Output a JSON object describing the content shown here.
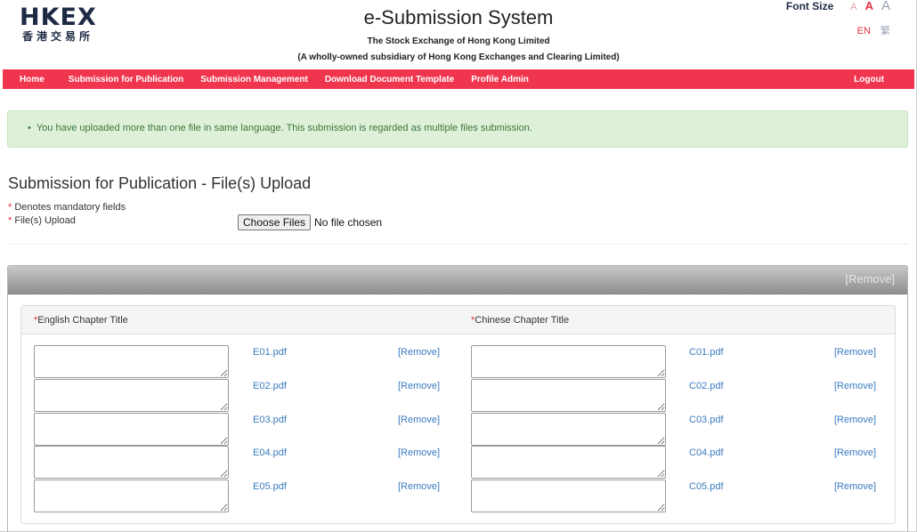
{
  "header": {
    "logo_text": "HKEX",
    "logo_chinese": "香港交易所",
    "title": "e-Submission System",
    "org_name": "The Stock Exchange of Hong Kong Limited",
    "org_subtitle": "(A wholly-owned subsidiary of Hong Kong Exchanges and Clearing Limited)",
    "font_size_label": "Font Size",
    "font_size_options": [
      "A",
      "A",
      "A"
    ],
    "lang_en": "EN",
    "lang_zh": "繁"
  },
  "nav": {
    "items": [
      {
        "label": "Home"
      },
      {
        "label": "Submission for Publication"
      },
      {
        "label": "Submission Management"
      },
      {
        "label": "Download Document Template"
      },
      {
        "label": "Profile Admin"
      }
    ],
    "logout": "Logout"
  },
  "alert": {
    "message": "You have uploaded more than one file in same language. This submission is regarded as multiple files submission."
  },
  "page": {
    "title": "Submission for Publication - File(s) Upload",
    "mandatory_note": "Denotes mandatory fields",
    "upload_label": "File(s) Upload",
    "choose_files": "Choose Files",
    "no_file": "No file chosen"
  },
  "panel": {
    "remove_label": "[Remove]",
    "english_header": "English Chapter Title",
    "chinese_header": "Chinese Chapter Title",
    "rows": [
      {
        "en_file": "E01.pdf",
        "zh_file": "C01.pdf",
        "remove": "[Remove]"
      },
      {
        "en_file": "E02.pdf",
        "zh_file": "C02.pdf",
        "remove": "[Remove]"
      },
      {
        "en_file": "E03.pdf",
        "zh_file": "C03.pdf",
        "remove": "[Remove]"
      },
      {
        "en_file": "E04.pdf",
        "zh_file": "C04.pdf",
        "remove": "[Remove]"
      },
      {
        "en_file": "E05.pdf",
        "zh_file": "C05.pdf",
        "remove": "[Remove]"
      }
    ]
  },
  "colors": {
    "nav_bg": "#f0364e",
    "link": "#3a7bbf",
    "alert_bg": "#dff0d8",
    "alert_text": "#3c763d",
    "required_star": "#e63246"
  }
}
